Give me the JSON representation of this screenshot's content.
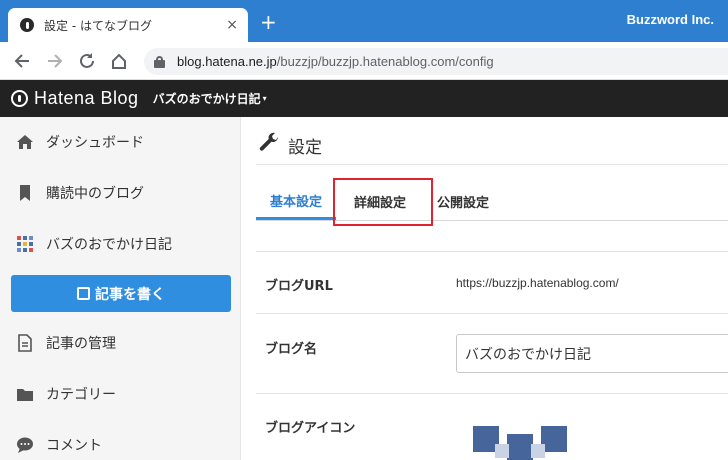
{
  "browser": {
    "tab_title": "設定 - はてなブログ",
    "tab_close": "×",
    "new_tab": "+",
    "window_brand": "Buzzword Inc.",
    "url_host": "blog.hatena.ne.jp",
    "url_path": "/buzzjp/buzzjp.hatenablog.com/config"
  },
  "header": {
    "logo": "Hatena Blog",
    "blog_name": "バズのおでかけ日記",
    "caret": "▾"
  },
  "sidebar": {
    "items": [
      {
        "label": "ダッシュボード",
        "icon": "home-icon"
      },
      {
        "label": "購読中のブログ",
        "icon": "bookmark-icon"
      },
      {
        "label": "バズのおでかけ日記",
        "icon": "blog-tiles-icon"
      },
      {
        "label": "記事の管理",
        "icon": "document-icon"
      },
      {
        "label": "カテゴリー",
        "icon": "folder-icon"
      },
      {
        "label": "コメント",
        "icon": "comment-icon"
      }
    ],
    "write_button": "記事を書く"
  },
  "main": {
    "title": "設定",
    "tabs": [
      {
        "label": "基本設定",
        "active": true
      },
      {
        "label": "詳細設定",
        "active": false,
        "highlighted": true
      },
      {
        "label": "公開設定",
        "active": false
      }
    ],
    "fields": {
      "blog_url_label": "ブログURL",
      "blog_url_value": "https://buzzjp.hatenablog.com/",
      "blog_name_label": "ブログ名",
      "blog_name_value": "バズのおでかけ日記",
      "blog_icon_label": "ブログアイコン"
    }
  },
  "colors": {
    "browser_bar": "#2f7fd0",
    "header_bg": "#222222",
    "accent": "#2f8ee0",
    "highlight_box": "#e0242f"
  }
}
